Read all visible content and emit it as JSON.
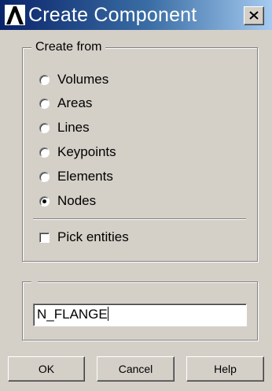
{
  "window": {
    "title": "Create Component",
    "app_icon": "ansys-logo-icon",
    "close_icon": "close-icon"
  },
  "create_from": {
    "legend": "Create from",
    "options": [
      {
        "label": "Volumes",
        "selected": false
      },
      {
        "label": "Areas",
        "selected": false
      },
      {
        "label": "Lines",
        "selected": false
      },
      {
        "label": "Keypoints",
        "selected": false
      },
      {
        "label": "Elements",
        "selected": false
      },
      {
        "label": "Nodes",
        "selected": true
      }
    ],
    "pick_entities": {
      "label": "Pick entities",
      "checked": false
    }
  },
  "name_field": {
    "value": "N_FLANGE"
  },
  "buttons": {
    "ok": "OK",
    "cancel": "Cancel",
    "help": "Help"
  }
}
